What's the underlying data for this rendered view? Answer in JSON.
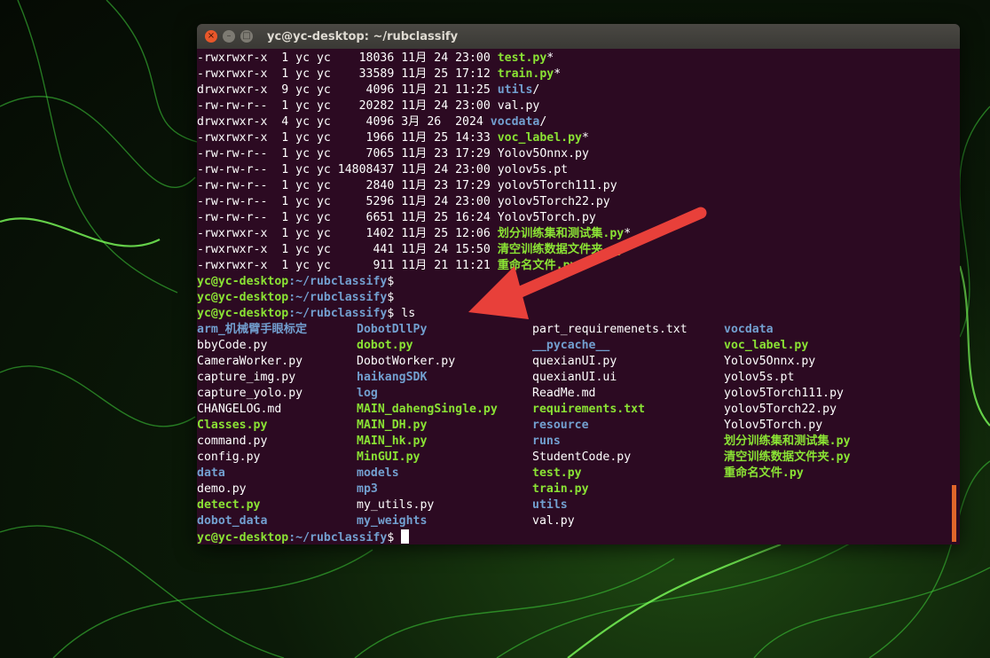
{
  "window": {
    "title": "yc@yc-desktop: ~/rubclassify",
    "buttons": {
      "close": "×",
      "minimize": "–",
      "maximize": "□"
    }
  },
  "prompt": {
    "user_host": "yc@yc-desktop",
    "path": ":~/rubclassify",
    "symbol": "$",
    "command": " ls"
  },
  "long_listing": [
    {
      "perms": "-rwxrwxr-x",
      "links": "1",
      "owner": "yc",
      "group": "yc",
      "size": "18036",
      "month": "11月",
      "day": "24",
      "time": "23:00",
      "name": "test.py",
      "suffix": "*",
      "color": "green"
    },
    {
      "perms": "-rwxrwxr-x",
      "links": "1",
      "owner": "yc",
      "group": "yc",
      "size": "33589",
      "month": "11月",
      "day": "25",
      "time": "17:12",
      "name": "train.py",
      "suffix": "*",
      "color": "green"
    },
    {
      "perms": "drwxrwxr-x",
      "links": "9",
      "owner": "yc",
      "group": "yc",
      "size": "4096",
      "month": "11月",
      "day": "21",
      "time": "11:25",
      "name": "utils",
      "suffix": "/",
      "color": "blue"
    },
    {
      "perms": "-rw-rw-r--",
      "links": "1",
      "owner": "yc",
      "group": "yc",
      "size": "20282",
      "month": "11月",
      "day": "24",
      "time": "23:00",
      "name": "val.py",
      "suffix": "",
      "color": "white"
    },
    {
      "perms": "drwxrwxr-x",
      "links": "4",
      "owner": "yc",
      "group": "yc",
      "size": "4096",
      "month": "3月",
      "day": "26",
      "time": "2024",
      "name": "vocdata",
      "suffix": "/",
      "color": "blue"
    },
    {
      "perms": "-rwxrwxr-x",
      "links": "1",
      "owner": "yc",
      "group": "yc",
      "size": "1966",
      "month": "11月",
      "day": "25",
      "time": "14:33",
      "name": "voc_label.py",
      "suffix": "*",
      "color": "green"
    },
    {
      "perms": "-rw-rw-r--",
      "links": "1",
      "owner": "yc",
      "group": "yc",
      "size": "7065",
      "month": "11月",
      "day": "23",
      "time": "17:29",
      "name": "Yolov5Onnx.py",
      "suffix": "",
      "color": "white"
    },
    {
      "perms": "-rw-rw-r--",
      "links": "1",
      "owner": "yc",
      "group": "yc",
      "size": "14808437",
      "month": "11月",
      "day": "24",
      "time": "23:00",
      "name": "yolov5s.pt",
      "suffix": "",
      "color": "white"
    },
    {
      "perms": "-rw-rw-r--",
      "links": "1",
      "owner": "yc",
      "group": "yc",
      "size": "2840",
      "month": "11月",
      "day": "23",
      "time": "17:29",
      "name": "yolov5Torch111.py",
      "suffix": "",
      "color": "white"
    },
    {
      "perms": "-rw-rw-r--",
      "links": "1",
      "owner": "yc",
      "group": "yc",
      "size": "5296",
      "month": "11月",
      "day": "24",
      "time": "23:00",
      "name": "yolov5Torch22.py",
      "suffix": "",
      "color": "white"
    },
    {
      "perms": "-rw-rw-r--",
      "links": "1",
      "owner": "yc",
      "group": "yc",
      "size": "6651",
      "month": "11月",
      "day": "25",
      "time": "16:24",
      "name": "Yolov5Torch.py",
      "suffix": "",
      "color": "white"
    },
    {
      "perms": "-rwxrwxr-x",
      "links": "1",
      "owner": "yc",
      "group": "yc",
      "size": "1402",
      "month": "11月",
      "day": "25",
      "time": "12:06",
      "name": "划分训练集和测试集.py",
      "suffix": "*",
      "color": "green"
    },
    {
      "perms": "-rwxrwxr-x",
      "links": "1",
      "owner": "yc",
      "group": "yc",
      "size": "441",
      "month": "11月",
      "day": "24",
      "time": "15:50",
      "name": "清空训练数据文件夹.py",
      "suffix": "*",
      "color": "green"
    },
    {
      "perms": "-rwxrwxr-x",
      "links": "1",
      "owner": "yc",
      "group": "yc",
      "size": "911",
      "month": "11月",
      "day": "21",
      "time": "11:21",
      "name": "重命名文件.py",
      "suffix": "*",
      "color": "green"
    }
  ],
  "ls_columns": [
    [
      {
        "name": "arm_机械臂手眼标定",
        "color": "blue"
      },
      {
        "name": "bbyCode.py",
        "color": "white"
      },
      {
        "name": "CameraWorker.py",
        "color": "white"
      },
      {
        "name": "capture_img.py",
        "color": "white"
      },
      {
        "name": "capture_yolo.py",
        "color": "white"
      },
      {
        "name": "CHANGELOG.md",
        "color": "white"
      },
      {
        "name": "Classes.py",
        "color": "green"
      },
      {
        "name": "command.py",
        "color": "white"
      },
      {
        "name": "config.py",
        "color": "white"
      },
      {
        "name": "data",
        "color": "blue"
      },
      {
        "name": "demo.py",
        "color": "white"
      },
      {
        "name": "detect.py",
        "color": "green"
      },
      {
        "name": "dobot_data",
        "color": "blue"
      }
    ],
    [
      {
        "name": "DobotDllPy",
        "color": "blue"
      },
      {
        "name": "dobot.py",
        "color": "green"
      },
      {
        "name": "DobotWorker.py",
        "color": "white"
      },
      {
        "name": "haikangSDK",
        "color": "blue"
      },
      {
        "name": "log",
        "color": "blue"
      },
      {
        "name": "MAIN_dahengSingle.py",
        "color": "green"
      },
      {
        "name": "MAIN_DH.py",
        "color": "green"
      },
      {
        "name": "MAIN_hk.py",
        "color": "green"
      },
      {
        "name": "MinGUI.py",
        "color": "green"
      },
      {
        "name": "models",
        "color": "blue"
      },
      {
        "name": "mp3",
        "color": "blue"
      },
      {
        "name": "my_utils.py",
        "color": "white"
      },
      {
        "name": "my_weights",
        "color": "blue"
      }
    ],
    [
      {
        "name": "part_requiremenets.txt",
        "color": "white"
      },
      {
        "name": "__pycache__",
        "color": "blue"
      },
      {
        "name": "quexianUI.py",
        "color": "white"
      },
      {
        "name": "quexianUI.ui",
        "color": "white"
      },
      {
        "name": "ReadMe.md",
        "color": "white"
      },
      {
        "name": "requirements.txt",
        "color": "green"
      },
      {
        "name": "resource",
        "color": "blue"
      },
      {
        "name": "runs",
        "color": "blue"
      },
      {
        "name": "StudentCode.py",
        "color": "white"
      },
      {
        "name": "test.py",
        "color": "green"
      },
      {
        "name": "train.py",
        "color": "green"
      },
      {
        "name": "utils",
        "color": "blue"
      },
      {
        "name": "val.py",
        "color": "white"
      }
    ],
    [
      {
        "name": "vocdata",
        "color": "blue"
      },
      {
        "name": "voc_label.py",
        "color": "green"
      },
      {
        "name": "Yolov5Onnx.py",
        "color": "white"
      },
      {
        "name": "yolov5s.pt",
        "color": "white"
      },
      {
        "name": "yolov5Torch111.py",
        "color": "white"
      },
      {
        "name": "yolov5Torch22.py",
        "color": "white"
      },
      {
        "name": "Yolov5Torch.py",
        "color": "white"
      },
      {
        "name": "划分训练集和测试集.py",
        "color": "green"
      },
      {
        "name": "清空训练数据文件夹.py",
        "color": "green"
      },
      {
        "name": "重命名文件.py",
        "color": "green"
      }
    ]
  ],
  "colors": {
    "terminal_bg": "#2c0a22",
    "exec": "#8ae234",
    "dir": "#729fcf",
    "text": "#ffffff",
    "arrow": "#e8403a"
  }
}
